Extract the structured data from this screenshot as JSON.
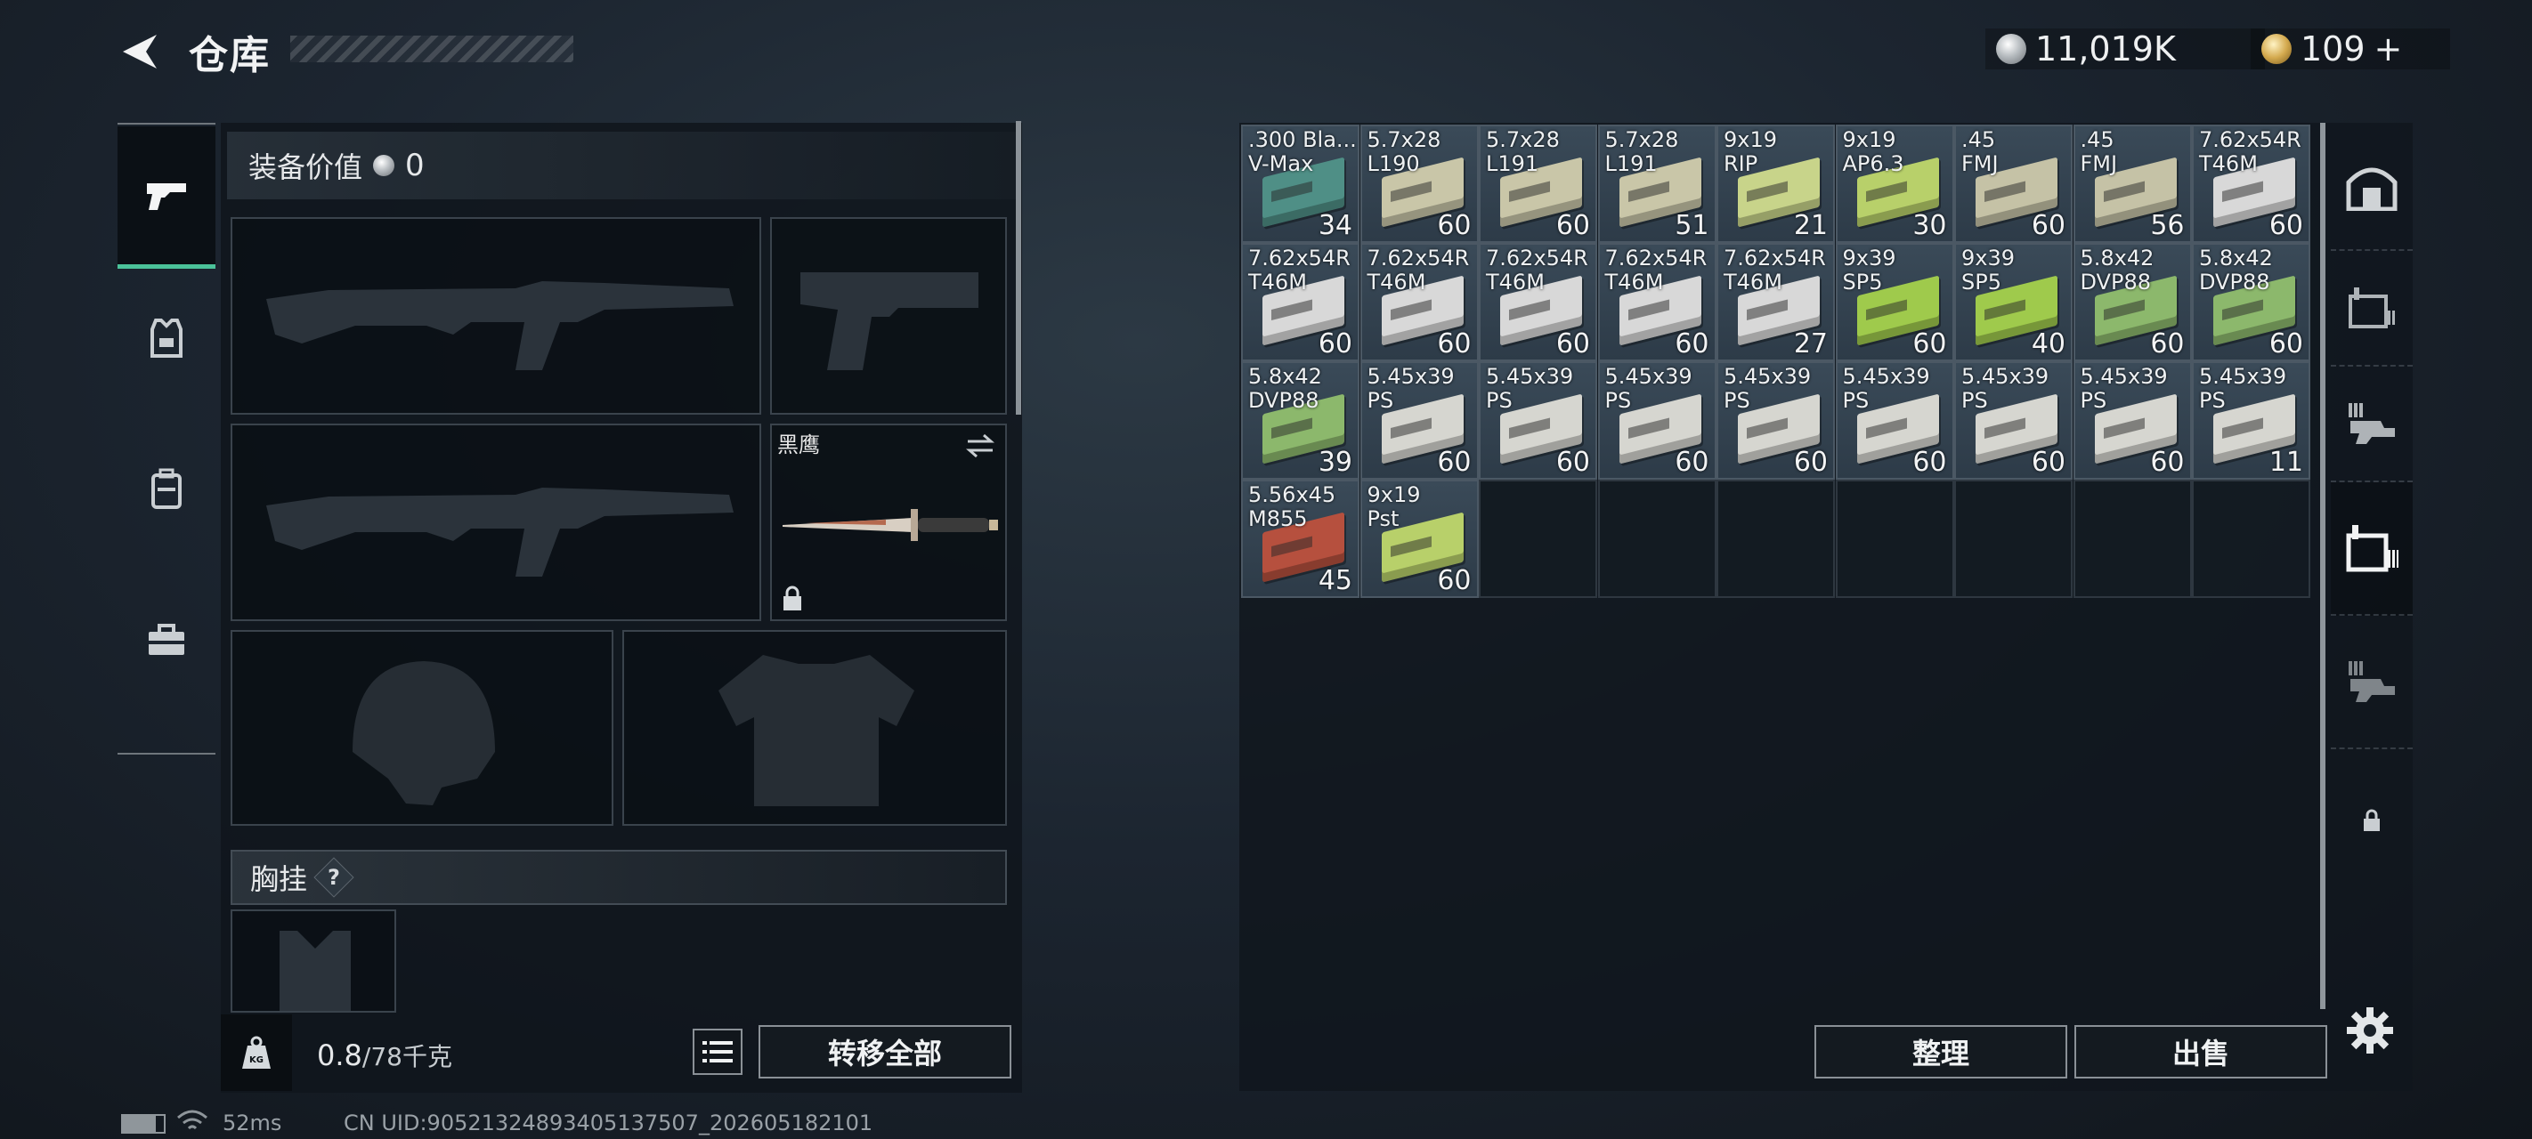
{
  "header": {
    "title": "仓库",
    "silver_amount": "11,019K",
    "gold_amount": "109",
    "gold_plus": "+"
  },
  "equipment": {
    "value_label": "装备价值",
    "value": "0",
    "knife_name": "黑鹰",
    "chest_label": "胸挂",
    "chest_help": "?"
  },
  "weight": {
    "current": "0.8",
    "max": "/78千克"
  },
  "buttons": {
    "transfer_all": "转移全部",
    "organize": "整理",
    "sell": "出售"
  },
  "status": {
    "ping": "52ms",
    "uid": "CN UID:9052132489340513750​7_202605182101"
  },
  "inventory": [
    {
      "name": ".300 Bla...\nV-Max",
      "qty": "34",
      "color": "#4f8f86"
    },
    {
      "name": "5.7x28\nL190",
      "qty": "60",
      "color": "#c9c6a8"
    },
    {
      "name": "5.7x28\nL191",
      "qty": "60",
      "color": "#c9c6a8"
    },
    {
      "name": "5.7x28\nL191",
      "qty": "51",
      "color": "#c9c6a8"
    },
    {
      "name": "9x19\nRIP",
      "qty": "21",
      "color": "#c8d48a"
    },
    {
      "name": "9x19\nAP6.3",
      "qty": "30",
      "color": "#b8d06a"
    },
    {
      "name": ".45\nFMJ",
      "qty": "60",
      "color": "#c5c2a6"
    },
    {
      "name": ".45\nFMJ",
      "qty": "56",
      "color": "#c5c2a6"
    },
    {
      "name": "7.62x54R\nT46M",
      "qty": "60",
      "color": "#d8d8d8"
    },
    {
      "name": "7.62x54R\nT46M",
      "qty": "60",
      "color": "#d8d8d8"
    },
    {
      "name": "7.62x54R\nT46M",
      "qty": "60",
      "color": "#d8d8d8"
    },
    {
      "name": "7.62x54R\nT46M",
      "qty": "60",
      "color": "#d8d8d8"
    },
    {
      "name": "7.62x54R\nT46M",
      "qty": "60",
      "color": "#d8d8d8"
    },
    {
      "name": "7.62x54R\nT46M",
      "qty": "27",
      "color": "#d8d8d8"
    },
    {
      "name": "9x39\nSP5",
      "qty": "60",
      "color": "#9fca4c"
    },
    {
      "name": "9x39\nSP5",
      "qty": "40",
      "color": "#9fca4c"
    },
    {
      "name": "5.8x42\nDVP88",
      "qty": "60",
      "color": "#8cb86c"
    },
    {
      "name": "5.8x42\nDVP88",
      "qty": "60",
      "color": "#8cb86c"
    },
    {
      "name": "5.8x42\nDVP88",
      "qty": "39",
      "color": "#8cb86c"
    },
    {
      "name": "5.45x39\nPS",
      "qty": "60",
      "color": "#d6d6d0"
    },
    {
      "name": "5.45x39\nPS",
      "qty": "60",
      "color": "#d6d6d0"
    },
    {
      "name": "5.45x39\nPS",
      "qty": "60",
      "color": "#d6d6d0"
    },
    {
      "name": "5.45x39\nPS",
      "qty": "60",
      "color": "#d6d6d0"
    },
    {
      "name": "5.45x39\nPS",
      "qty": "60",
      "color": "#d6d6d0"
    },
    {
      "name": "5.45x39\nPS",
      "qty": "60",
      "color": "#d6d6d0"
    },
    {
      "name": "5.45x39\nPS",
      "qty": "60",
      "color": "#d6d6d0"
    },
    {
      "name": "5.45x39\nPS",
      "qty": "11",
      "color": "#d6d6d0"
    },
    {
      "name": "5.56x45\nM855",
      "qty": "45",
      "color": "#b6503e"
    },
    {
      "name": "9x19\nPst",
      "qty": "60",
      "color": "#b8d06a"
    }
  ]
}
